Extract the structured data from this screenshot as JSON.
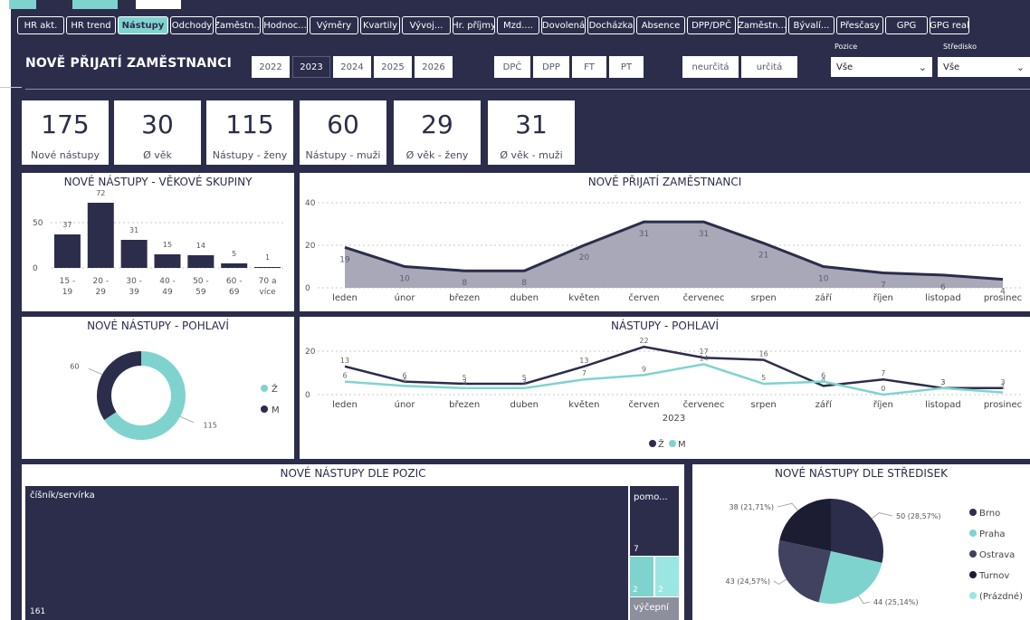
{
  "nav": {
    "tabs": [
      "HR akt.",
      "HR trend",
      "Nástupy",
      "Odchody",
      "Zaměstn...",
      "Hodnoc...",
      "Výměry",
      "Kvartily",
      "Vývoj...",
      "Hr. příjmy",
      "Mzd....",
      "Dovolená",
      "Docházka",
      "Absence",
      "DPP/DPČ",
      "Zaměstn...",
      "Bývalí...",
      "Přesčasy",
      "GPG",
      "GPG real"
    ],
    "active_index": 2
  },
  "page_title": "NOVĚ PŘIJATÍ ZAMĚSTNANCI",
  "years": [
    "2022",
    "2023",
    "2024",
    "2025",
    "2026"
  ],
  "selected_year": "2023",
  "contract_types": [
    "DPČ",
    "DPP",
    "FT",
    "PT"
  ],
  "duration_types": [
    "neurčitá",
    "určitá"
  ],
  "slicers": {
    "pozice": {
      "label": "Pozice",
      "value": "Vše"
    },
    "stredisko": {
      "label": "Středisko",
      "value": "Vše"
    }
  },
  "kpis": [
    {
      "value": "175",
      "label": "Nové nástupy"
    },
    {
      "value": "30",
      "label": "Ø věk"
    },
    {
      "value": "115",
      "label": "Nástupy - ženy"
    },
    {
      "value": "60",
      "label": "Nástupy - muži"
    },
    {
      "value": "29",
      "label": "Ø věk - ženy"
    },
    {
      "value": "31",
      "label": "Ø věk - muži"
    }
  ],
  "colors": {
    "dark": "#2b2d4b",
    "teal": "#7fd3cf",
    "slate": "#40425f",
    "area": "#9e9fb0"
  },
  "chart_data": [
    {
      "type": "bar",
      "title": "NOVÉ NÁSTUPY - VĚKOVÉ SKUPINY",
      "categories": [
        "15 - 19",
        "20 - 29",
        "30 - 39",
        "40 - 49",
        "50 - 59",
        "60 - 69",
        "70 a více"
      ],
      "values": [
        37,
        72,
        31,
        15,
        14,
        5,
        1
      ],
      "yticks": [
        0,
        50
      ],
      "ylim": [
        0,
        80
      ]
    },
    {
      "type": "area",
      "title": "NOVĚ PŘIJATÍ ZAMĚSTNANCI",
      "categories": [
        "leden",
        "únor",
        "březen",
        "duben",
        "květen",
        "červen",
        "červenec",
        "srpen",
        "září",
        "říjen",
        "listopad",
        "prosinec"
      ],
      "values": [
        19,
        10,
        8,
        8,
        20,
        31,
        31,
        21,
        10,
        7,
        6,
        4
      ],
      "yticks": [
        0,
        20,
        40
      ],
      "ylim": [
        0,
        40
      ]
    },
    {
      "type": "pie",
      "title": "NOVÉ NÁSTUPY - POHLAVÍ",
      "donut": true,
      "series": [
        {
          "name": "Ž",
          "value": 115,
          "color": "#7fd3cf"
        },
        {
          "name": "M",
          "value": 60,
          "color": "#2b2d4b"
        }
      ]
    },
    {
      "type": "line",
      "title": "NÁSTUPY - POHLAVÍ",
      "categories": [
        "leden",
        "únor",
        "březen",
        "duben",
        "květen",
        "červen",
        "červenec",
        "srpen",
        "září",
        "říjen",
        "listopad",
        "prosinec"
      ],
      "x_group_label": "2023",
      "yticks": [
        0,
        20
      ],
      "ylim": [
        0,
        25
      ],
      "series": [
        {
          "name": "Ž",
          "color": "#2b2d4b",
          "values": [
            13,
            6,
            5,
            5,
            13,
            22,
            17,
            16,
            4,
            7,
            3,
            3
          ]
        },
        {
          "name": "M",
          "color": "#7fd3cf",
          "values": [
            6,
            4,
            3,
            3,
            7,
            9,
            14,
            5,
            6,
            0,
            3,
            1
          ]
        }
      ],
      "labels": [
        13,
        6,
        5,
        5,
        13,
        22,
        9,
        17,
        16,
        5,
        4,
        7,
        3,
        3
      ],
      "legend": [
        "Ž",
        "M"
      ]
    },
    {
      "type": "treemap",
      "title": "NOVÉ NÁSTUPY DLE POZIC",
      "items": [
        {
          "label": "číšník/servírka",
          "value": 161
        },
        {
          "label": "pomo...",
          "value": 7
        },
        {
          "label": "",
          "value": 2
        },
        {
          "label": "",
          "value": 2
        },
        {
          "label": "výčepní",
          "value": ""
        }
      ]
    },
    {
      "type": "pie",
      "title": "NOVÉ NÁSTUPY DLE STŘEDISEK",
      "series": [
        {
          "name": "Brno",
          "value": 50,
          "label": "50 (28,57%)",
          "color": "#2b2d4b"
        },
        {
          "name": "Praha",
          "value": 44,
          "label": "44 (25,14%)",
          "color": "#7fd3cf"
        },
        {
          "name": "Ostrava",
          "value": 43,
          "label": "43 (24,57%)",
          "color": "#40425f"
        },
        {
          "name": "Turnov",
          "value": 38,
          "label": "38 (21,71%)",
          "color": "#1c1d33"
        },
        {
          "name": "(Prázdné)",
          "value": 0,
          "label": "",
          "color": "#9be6e2"
        }
      ]
    }
  ]
}
